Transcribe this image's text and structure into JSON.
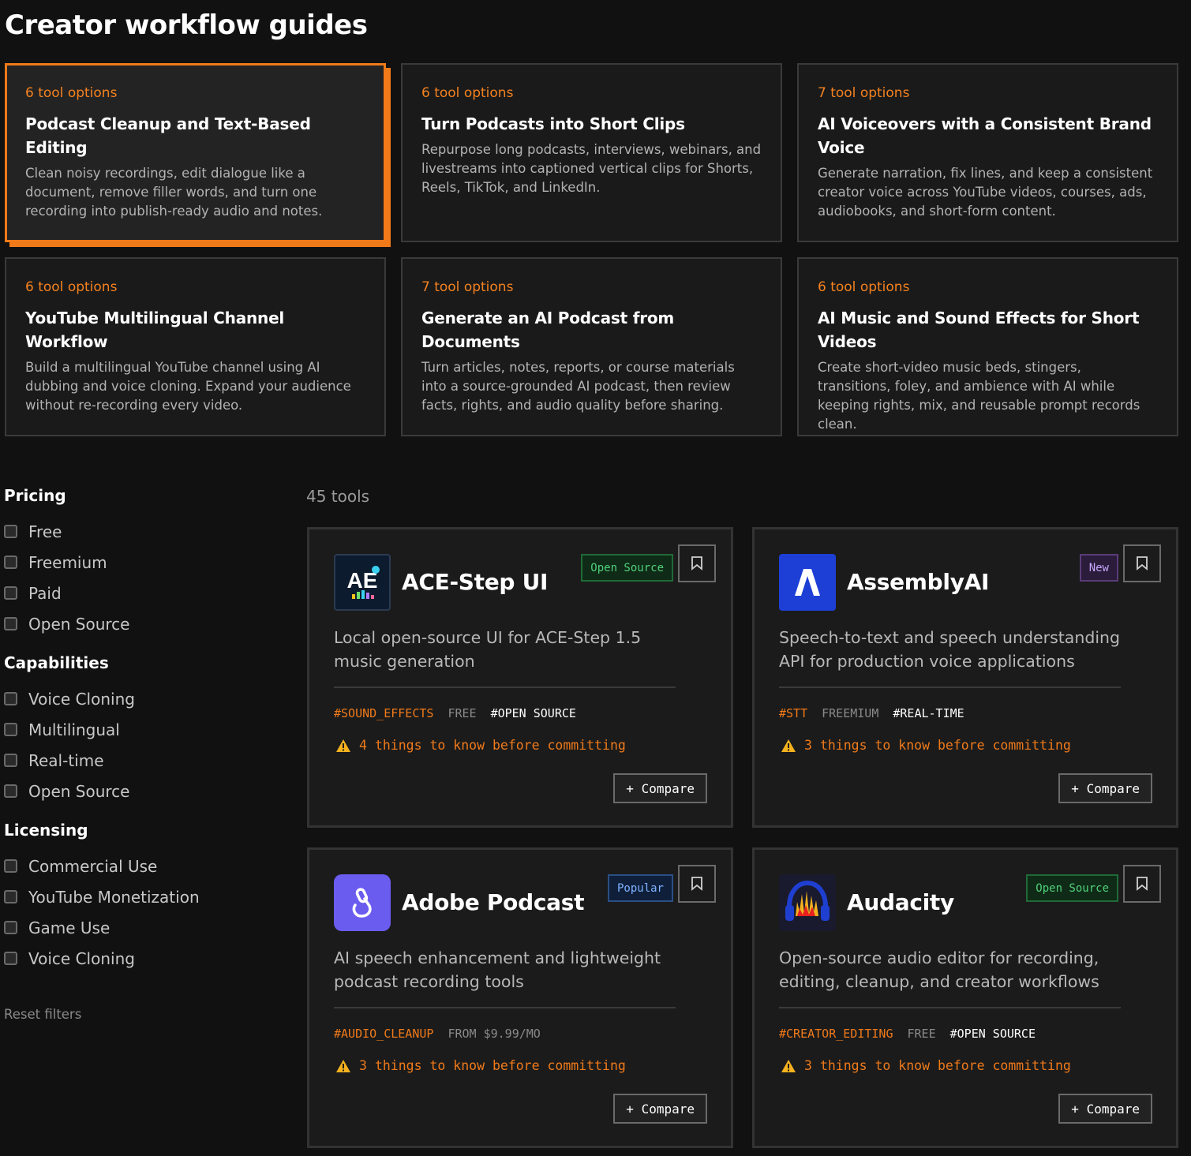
{
  "page": {
    "title": "Creator workflow guides"
  },
  "guides": [
    {
      "count": "6 tool options",
      "title": "Podcast Cleanup and Text-Based Editing",
      "desc": "Clean noisy recordings, edit dialogue like a document, remove filler words, and turn one recording into publish-ready audio and notes."
    },
    {
      "count": "6 tool options",
      "title": "Turn Podcasts into Short Clips",
      "desc": "Repurpose long podcasts, interviews, webinars, and livestreams into captioned vertical clips for Shorts, Reels, TikTok, and LinkedIn."
    },
    {
      "count": "7 tool options",
      "title": "AI Voiceovers with a Consistent Brand Voice",
      "desc": "Generate narration, fix lines, and keep a consistent creator voice across YouTube videos, courses, ads, audiobooks, and short-form content."
    },
    {
      "count": "6 tool options",
      "title": "YouTube Multilingual Channel Workflow",
      "desc": "Build a multilingual YouTube channel using AI dubbing and voice cloning. Expand your audience without re-recording every video."
    },
    {
      "count": "7 tool options",
      "title": "Generate an AI Podcast from Documents",
      "desc": "Turn articles, notes, reports, or course materials into a source-grounded AI podcast, then review facts, rights, and audio quality before sharing."
    },
    {
      "count": "6 tool options",
      "title": "AI Music and Sound Effects for Short Videos",
      "desc": "Create short-video music beds, stingers, transitions, foley, and ambience with AI while keeping rights, mix, and reusable prompt records clean."
    }
  ],
  "filters": {
    "pricing": {
      "heading": "Pricing",
      "options": [
        "Free",
        "Freemium",
        "Paid",
        "Open Source"
      ]
    },
    "capabilities": {
      "heading": "Capabilities",
      "options": [
        "Voice Cloning",
        "Multilingual",
        "Real-time",
        "Open Source"
      ]
    },
    "licensing": {
      "heading": "Licensing",
      "options": [
        "Commercial Use",
        "YouTube Monetization",
        "Game Use",
        "Voice Cloning"
      ]
    },
    "reset": "Reset filters"
  },
  "tools_count": "45 tools",
  "tools": [
    {
      "name": "ACE-Step UI",
      "logo_icon": "ace-step-logo",
      "logo_text": "AE",
      "badge": "Open Source",
      "desc": "Local open-source UI for ACE-Step 1.5 music generation",
      "tag_category": "#SOUND_EFFECTS",
      "tag_price": "FREE",
      "tag_feature": "#OPEN SOURCE",
      "warning_count": "4",
      "warning_text": "things to know before committing",
      "compare": "+ Compare"
    },
    {
      "name": "AssemblyAI",
      "logo_icon": "assemblyai-logo",
      "logo_text": "Λ",
      "badge": "New",
      "desc": "Speech-to-text and speech understanding API for production voice applications",
      "tag_category": "#STT",
      "tag_price": "FREEMIUM",
      "tag_feature": "#REAL-TIME",
      "warning_count": "3",
      "warning_text": "things to know before committing",
      "compare": "+ Compare"
    },
    {
      "name": "Adobe Podcast",
      "logo_icon": "adobe-podcast-logo",
      "logo_text": "",
      "badge": "Popular",
      "desc": "AI speech enhancement and lightweight podcast recording tools",
      "tag_category": "#AUDIO_CLEANUP",
      "tag_price": "FROM $9.99/MO",
      "tag_feature": "",
      "warning_count": "3",
      "warning_text": "things to know before committing",
      "compare": "+ Compare"
    },
    {
      "name": "Audacity",
      "logo_icon": "audacity-logo",
      "logo_text": "",
      "badge": "Open Source",
      "desc": "Open-source audio editor for recording, editing, cleanup, and creator workflows",
      "tag_category": "#CREATOR_EDITING",
      "tag_price": "FREE",
      "tag_feature": "#OPEN SOURCE",
      "warning_count": "3",
      "warning_text": "things to know before committing",
      "compare": "+ Compare"
    }
  ],
  "colors": {
    "accent": "#f07a1a",
    "background": "#111111",
    "card": "#1b1b1b",
    "badge_open_source": "#4fd17a",
    "badge_new": "#c9a7ff",
    "badge_popular": "#7fb2ff"
  }
}
